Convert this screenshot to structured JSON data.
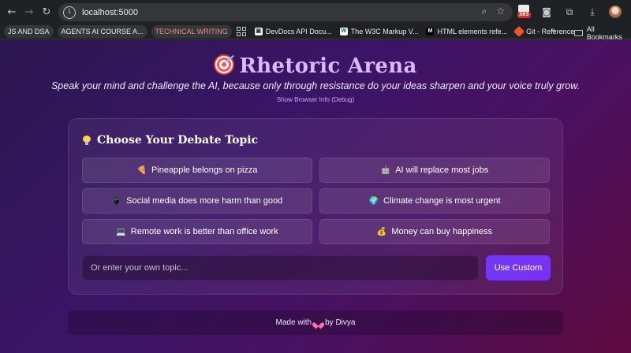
{
  "browser": {
    "url": "localhost:5000",
    "extension_badge": "383",
    "bookmarks": [
      {
        "label": "JS AND DSA",
        "style": "pill"
      },
      {
        "label": "AGENTS AI COURSE A...",
        "style": "pill"
      },
      {
        "label": "TECHNICAL WRITING",
        "style": "pill-red"
      },
      {
        "label": "DevDocs API Docu...",
        "icon": "devdocs-icon"
      },
      {
        "label": "The W3C Markup V...",
        "icon": "w3c-icon"
      },
      {
        "label": "HTML elements refe...",
        "icon": "mdn-icon"
      },
      {
        "label": "Git - Reference",
        "icon": "git-icon"
      }
    ],
    "all_bookmarks": "All Bookmarks"
  },
  "header": {
    "title": "Rhetoric Arena",
    "subtitle": "Speak your mind and challenge the AI, because only through resistance do your ideas sharpen and your voice truly grow.",
    "debug_link": "Show Browser Info (Debug)"
  },
  "topics": {
    "heading": "Choose Your Debate Topic",
    "items": [
      {
        "emoji": "🍕",
        "label": "Pineapple belongs on pizza"
      },
      {
        "emoji": "🤖",
        "label": "AI will replace most jobs"
      },
      {
        "emoji": "📱",
        "label": "Social media does more harm than good"
      },
      {
        "emoji": "🌍",
        "label": "Climate change is most urgent"
      },
      {
        "emoji": "💻",
        "label": "Remote work is better than office work"
      },
      {
        "emoji": "💰",
        "label": "Money can buy happiness"
      }
    ],
    "custom_placeholder": "Or enter your own topic...",
    "custom_value": "",
    "custom_button": "Use Custom"
  },
  "footer": {
    "made_with": "Made with",
    "by": "by Divya"
  },
  "colors": {
    "accent": "#7b2ff7",
    "title": "#d9b8ff",
    "heart": "#ff6fa9"
  }
}
